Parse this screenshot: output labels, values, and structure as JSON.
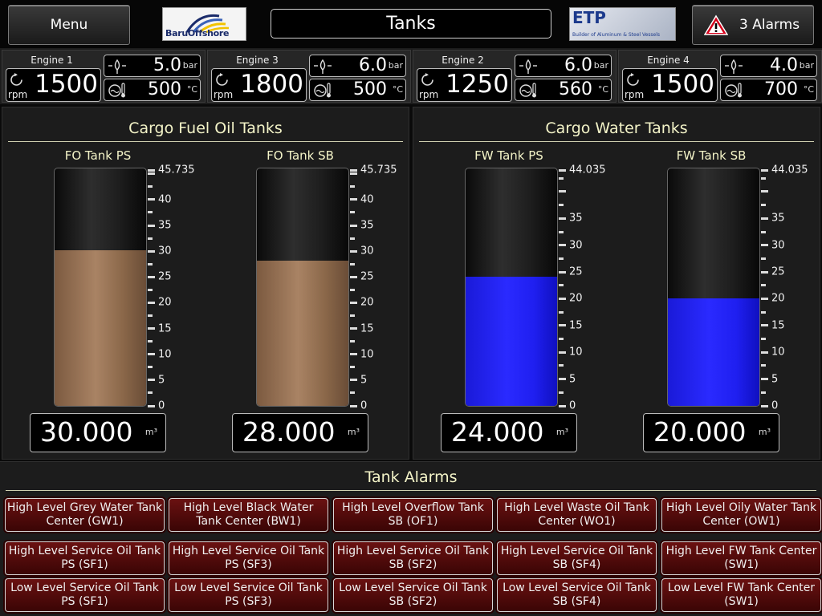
{
  "header": {
    "menu_label": "Menu",
    "title": "Tanks",
    "logo_left_text": "BaruOffshore",
    "logo_right_text": "ETP",
    "logo_right_subtext": "Builder of Aluminum & Steel Vessels",
    "alarms_label": "3 Alarms"
  },
  "engines": [
    {
      "name": "Engine 1",
      "rpm": "1500",
      "rpm_unit": "rpm",
      "pressure": "5.0",
      "pressure_unit": "bar",
      "temp": "500",
      "temp_unit": "°C"
    },
    {
      "name": "Engine 3",
      "rpm": "1800",
      "rpm_unit": "rpm",
      "pressure": "6.0",
      "pressure_unit": "bar",
      "temp": "500",
      "temp_unit": "°C"
    },
    {
      "name": "Engine 2",
      "rpm": "1250",
      "rpm_unit": "rpm",
      "pressure": "6.0",
      "pressure_unit": "bar",
      "temp": "560",
      "temp_unit": "°C"
    },
    {
      "name": "Engine 4",
      "rpm": "1500",
      "rpm_unit": "rpm",
      "pressure": "4.0",
      "pressure_unit": "bar",
      "temp": "700",
      "temp_unit": "°C"
    }
  ],
  "fuel_panel": {
    "title": "Cargo Fuel Oil Tanks",
    "tanks": [
      {
        "name": "FO Tank PS",
        "value": "30.000",
        "unit": "m³",
        "level": 30.0,
        "max": 45.735,
        "max_label": "45.735",
        "scale_labels": [
          "40",
          "35",
          "30",
          "25",
          "20",
          "15",
          "10",
          "5",
          "0"
        ]
      },
      {
        "name": "FO Tank SB",
        "value": "28.000",
        "unit": "m³",
        "level": 28.0,
        "max": 45.735,
        "max_label": "45.735",
        "scale_labels": [
          "40",
          "35",
          "30",
          "25",
          "20",
          "15",
          "10",
          "5",
          "0"
        ]
      }
    ]
  },
  "water_panel": {
    "title": "Cargo Water Tanks",
    "tanks": [
      {
        "name": "FW Tank PS",
        "value": "24.000",
        "unit": "m³",
        "level": 24.0,
        "max": 44.035,
        "max_label": "44.035",
        "scale_labels": [
          "35",
          "30",
          "25",
          "20",
          "15",
          "10",
          "5",
          "0"
        ]
      },
      {
        "name": "FW Tank SB",
        "value": "20.000",
        "unit": "m³",
        "level": 20.0,
        "max": 44.035,
        "max_label": "44.035",
        "scale_labels": [
          "35",
          "30",
          "25",
          "20",
          "15",
          "10",
          "5",
          "0"
        ]
      }
    ]
  },
  "alarms": {
    "title": "Tank Alarms",
    "rows": [
      [
        "High Level Grey Water Tank Center (GW1)",
        "High Level Black Water Tank Center (BW1)",
        "High Level Overflow Tank SB (OF1)",
        "High Level Waste Oil Tank Center (WO1)",
        "High Level Oily Water Tank Center (OW1)"
      ],
      [
        "High Level Service Oil Tank PS (SF1)",
        "High Level Service Oil Tank PS (SF3)",
        "High Level Service Oil Tank SB (SF2)",
        "High Level Service Oil Tank SB (SF4)",
        "High Level FW Tank Center (SW1)"
      ],
      [
        "Low Level Service Oil Tank PS (SF1)",
        "Low Level Service Oil Tank PS (SF3)",
        "Low Level Service Oil Tank SB (SF2)",
        "Low Level Service Oil Tank SB (SF4)",
        "Low Level FW Tank Center (SW1)"
      ]
    ]
  },
  "colors": {
    "oil_fill": "#a98364",
    "water_fill": "#2a2aff",
    "alarm_bg": "#5a0c0c",
    "title_text": "#f4f4c8"
  }
}
